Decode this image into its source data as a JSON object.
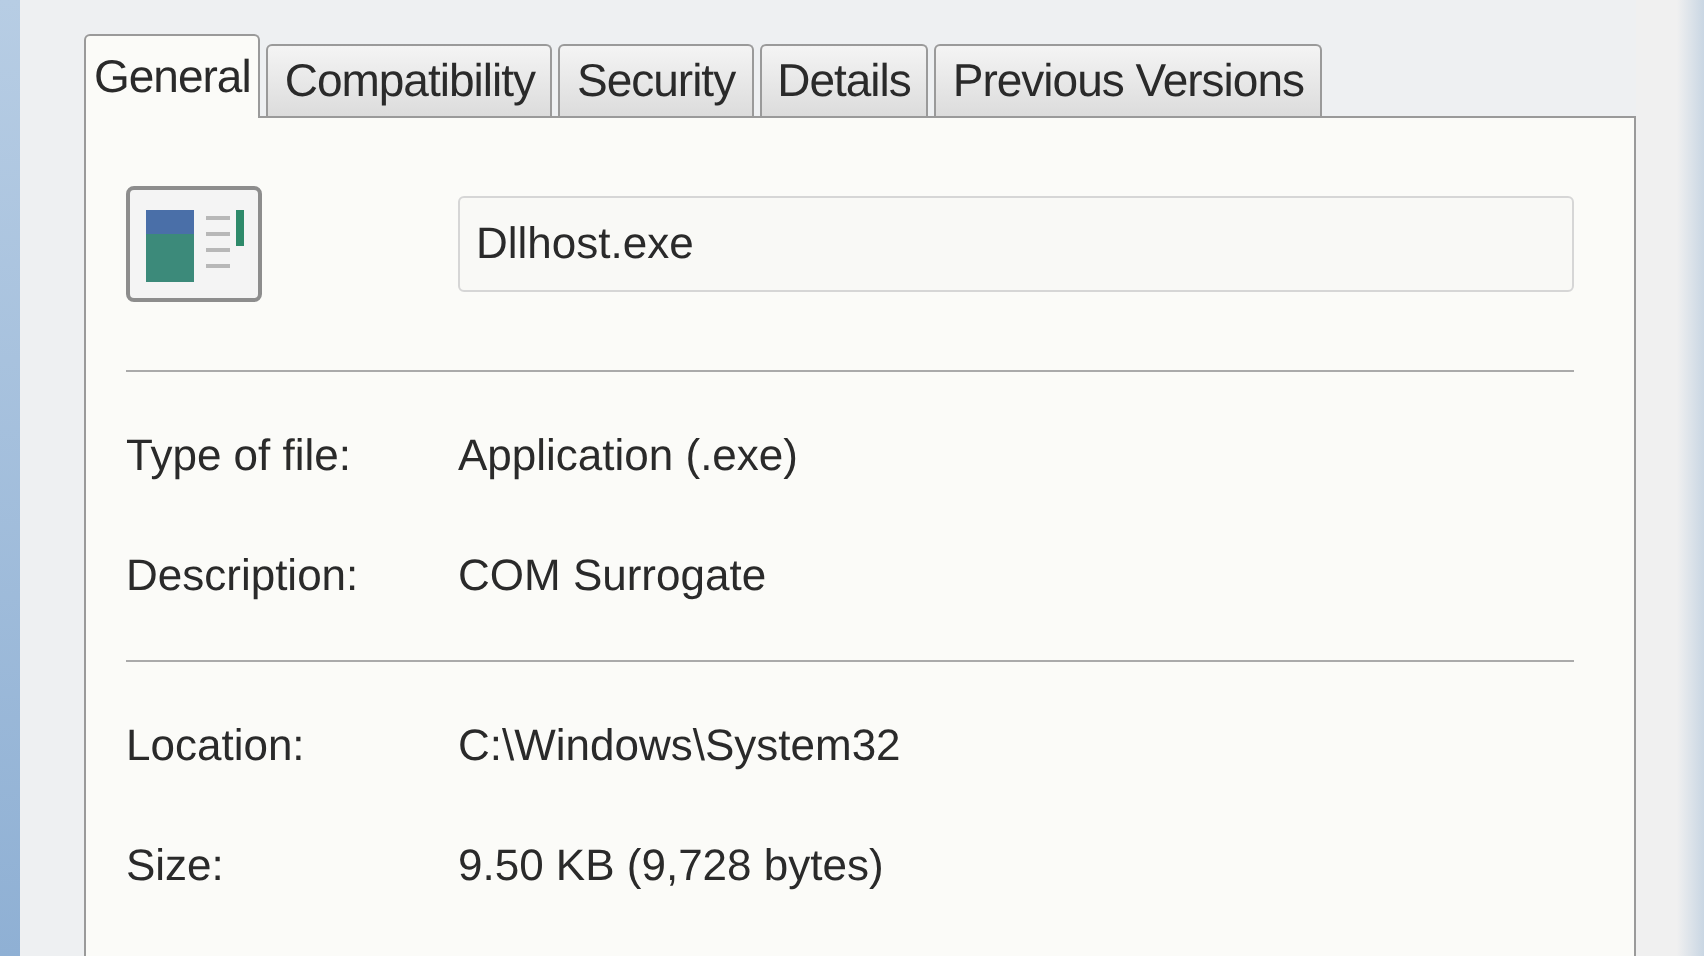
{
  "tabs": [
    {
      "label": "General",
      "selected": true
    },
    {
      "label": "Compatibility",
      "selected": false
    },
    {
      "label": "Security",
      "selected": false
    },
    {
      "label": "Details",
      "selected": false
    },
    {
      "label": "Previous Versions",
      "selected": false
    }
  ],
  "file_name": {
    "value": "Dllhost.exe"
  },
  "groups": [
    [
      {
        "label": "Type of file:",
        "value": "Application (.exe)"
      },
      {
        "label": "Description:",
        "value": "COM Surrogate"
      }
    ],
    [
      {
        "label": "Location:",
        "value": "C:\\Windows\\System32"
      },
      {
        "label": "Size:",
        "value": "9.50 KB (9,728 bytes)"
      }
    ]
  ]
}
